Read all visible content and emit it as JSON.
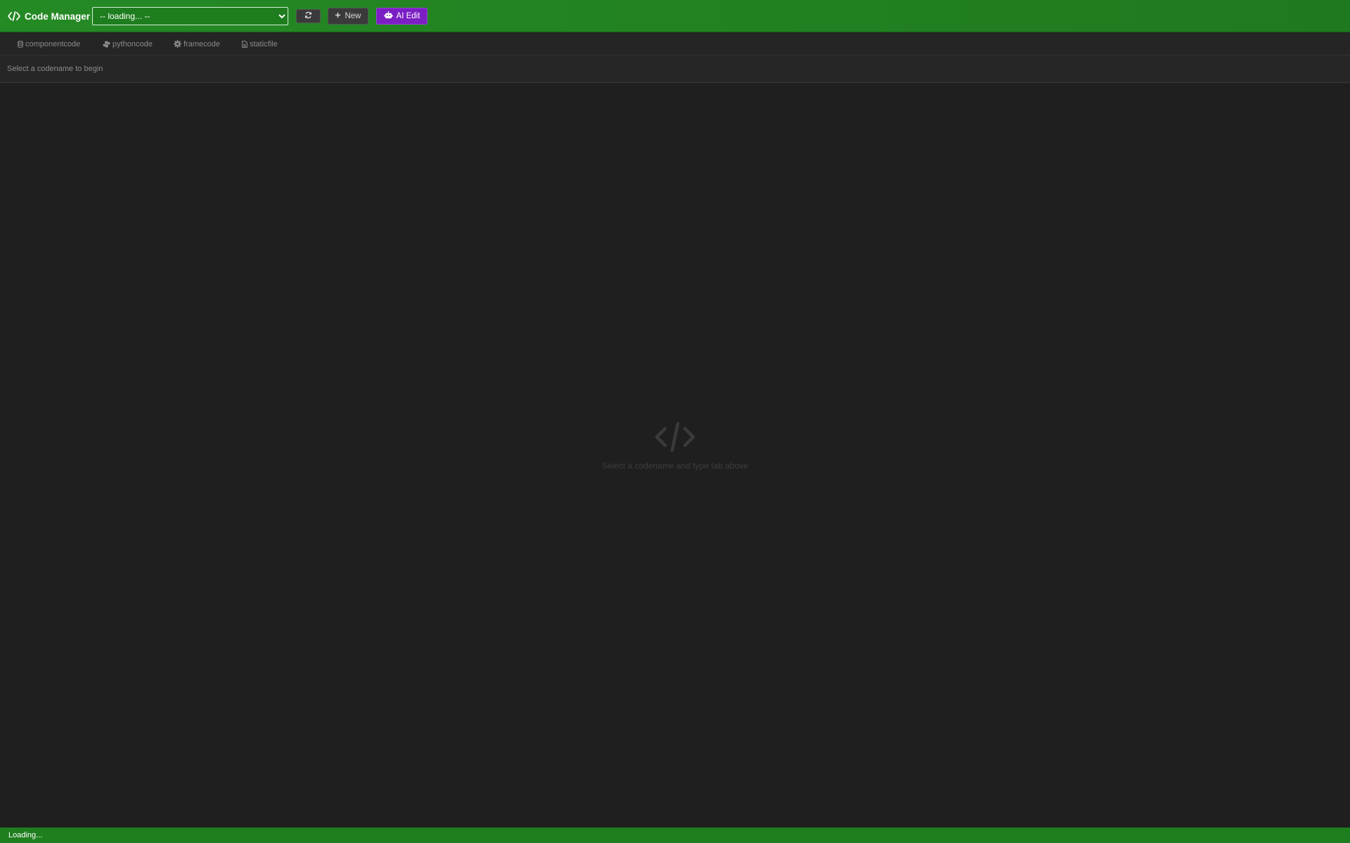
{
  "app": {
    "title": "Code Manager",
    "colors": {
      "header_green": "#248a24",
      "ai_purple": "#7b1fc4",
      "background": "#1f1f1f"
    }
  },
  "toolbar": {
    "codename_select": {
      "selected": "-- loading... --",
      "options": [
        "-- loading... --"
      ]
    },
    "refresh_icon": "refresh-icon",
    "new_label": "New",
    "ai_edit_label": "AI Edit"
  },
  "tabs": [
    {
      "label": "componentcode",
      "icon": "database-icon"
    },
    {
      "label": "pythoncode",
      "icon": "python-icon"
    },
    {
      "label": "framecode",
      "icon": "gear-icon"
    },
    {
      "label": "staticfile",
      "icon": "file-icon"
    }
  ],
  "subbar": {
    "hint": "Select a codename to begin"
  },
  "empty_state": {
    "icon": "code-icon",
    "text": "Select a codename and type tab above"
  },
  "statusbar": {
    "text": "Loading..."
  }
}
